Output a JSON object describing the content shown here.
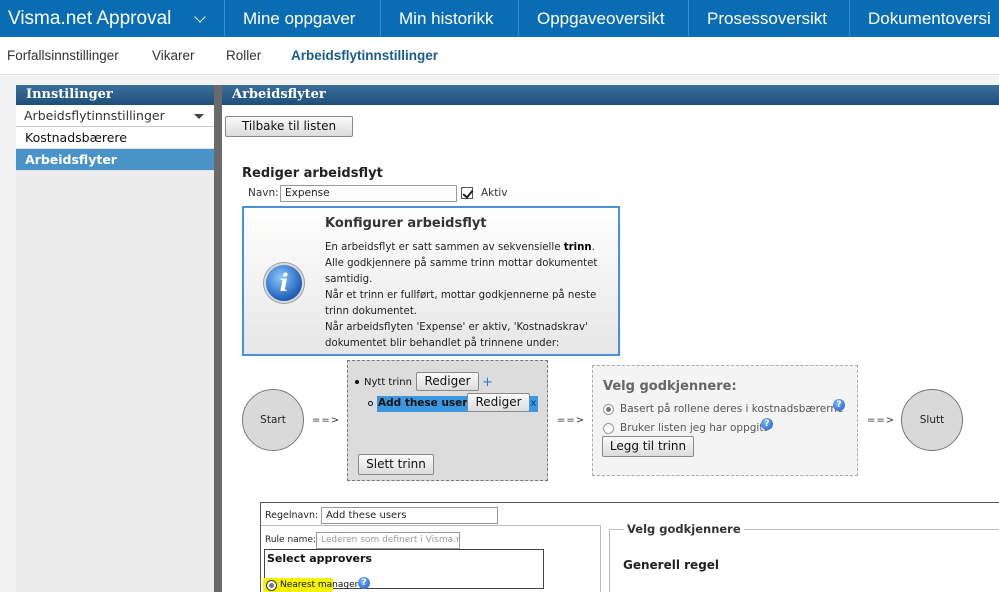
{
  "app": {
    "title": "Visma.net Approval"
  },
  "top_nav": [
    "Mine oppgaver",
    "Min historikk",
    "Oppgaveoversikt",
    "Prosessoversikt",
    "Dokumentoversi"
  ],
  "sub_nav": {
    "items": [
      "Forfallsinnstillinger",
      "Vikarer",
      "Roller",
      "Arbeidsflytinnstillinger"
    ],
    "active_index": 3
  },
  "sidebar": {
    "header": "Innstilinger",
    "select_value": "Arbeidsflytinnstillinger",
    "items": [
      "Kostnadsbærere",
      "Arbeidsflyter"
    ],
    "active_index": 1
  },
  "main": {
    "header": "Arbeidsflyter",
    "back_button": "Tilbake til listen",
    "edit_title": "Rediger arbeidsflyt",
    "name_label": "Navn:",
    "name_value": "Expense",
    "active_label": "Aktiv",
    "active_checked": true
  },
  "info": {
    "title": "Konfigurer arbeidsflyt",
    "line1_pre": "En arbeidsflyt er satt sammen av sekvensielle ",
    "line1_bold": "trinn",
    "line1_post": ".",
    "line2": "Alle godkjennere på samme trinn mottar dokumentet samtidig.",
    "line3": "Når et trinn er fullført, mottar godkjennerne på neste trinn dokumentet.",
    "line4": "Når arbeidsflyten 'Expense' er aktiv, 'Kostnadskrav' dokumentet blir behandlet på trinnene under:"
  },
  "flow": {
    "start": "Start",
    "end": "Slutt",
    "arrow": "==>",
    "new_step_label": "Nytt trinn",
    "edit_button": "Rediger",
    "selected_item": "Add these users",
    "delete_step": "Slett trinn",
    "x_mark": "x",
    "plus": "+"
  },
  "approvers": {
    "title": "Velg godkjennere:",
    "options": [
      "Basert på rollene deres i kostnadsbærerne",
      "Bruker listen jeg har oppgitt"
    ],
    "selected_index": 0,
    "add_step": "Legg til trinn",
    "help": "?"
  },
  "rules": {
    "rule_name_label": "Regelnavn:",
    "rule_name_value": "Add these users",
    "rule_name_en_label": "Rule name:",
    "rule_name_en_placeholder": "Lederen som definert i Visma.n",
    "select_approvers": "Select approvers",
    "nearest_manager": "Nearest manager",
    "fieldset_legend": "Velg godkjennere",
    "general_rule": "Generell regel"
  }
}
